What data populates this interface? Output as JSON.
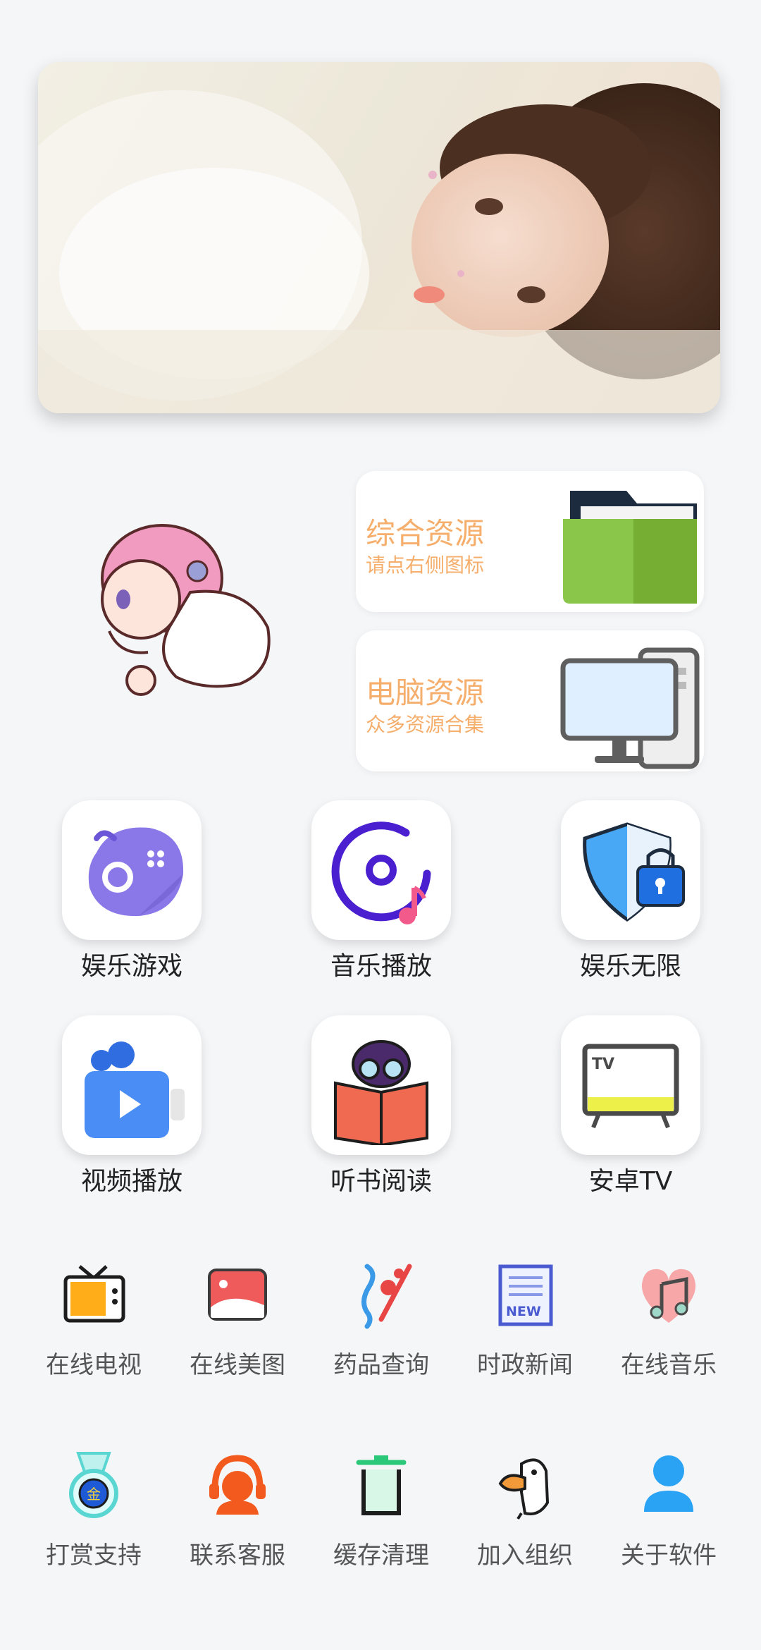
{
  "resources": [
    {
      "title": "综合资源",
      "subtitle": "请点右侧图标",
      "icon": "folder-icon"
    },
    {
      "title": "电脑资源",
      "subtitle": "众多资源合集",
      "icon": "computer-icon"
    }
  ],
  "apps": [
    {
      "label": "娱乐游戏",
      "icon": "gamepad-icon"
    },
    {
      "label": "音乐播放",
      "icon": "music-disc-icon"
    },
    {
      "label": "娱乐无限",
      "icon": "shield-lock-icon"
    },
    {
      "label": "视频播放",
      "icon": "video-camera-icon"
    },
    {
      "label": "听书阅读",
      "icon": "reading-icon"
    },
    {
      "label": "安卓TV",
      "icon": "tv-icon"
    }
  ],
  "tools": [
    {
      "label": "在线电视",
      "icon": "retro-tv-icon"
    },
    {
      "label": "在线美图",
      "icon": "photo-icon"
    },
    {
      "label": "药品查询",
      "icon": "music-notes-icon"
    },
    {
      "label": "时政新闻",
      "icon": "news-icon"
    },
    {
      "label": "在线音乐",
      "icon": "heart-music-icon"
    },
    {
      "label": "打赏支持",
      "icon": "gold-medal-icon",
      "badge": "金"
    },
    {
      "label": "联系客服",
      "icon": "headset-icon"
    },
    {
      "label": "缓存清理",
      "icon": "trash-icon"
    },
    {
      "label": "加入组织",
      "icon": "duck-icon"
    },
    {
      "label": "关于软件",
      "icon": "user-icon"
    }
  ],
  "news_badge": "NEW",
  "tv_badge": "TV",
  "colors": {
    "accent": "#f5ae6b",
    "background": "#f5f6f8"
  }
}
